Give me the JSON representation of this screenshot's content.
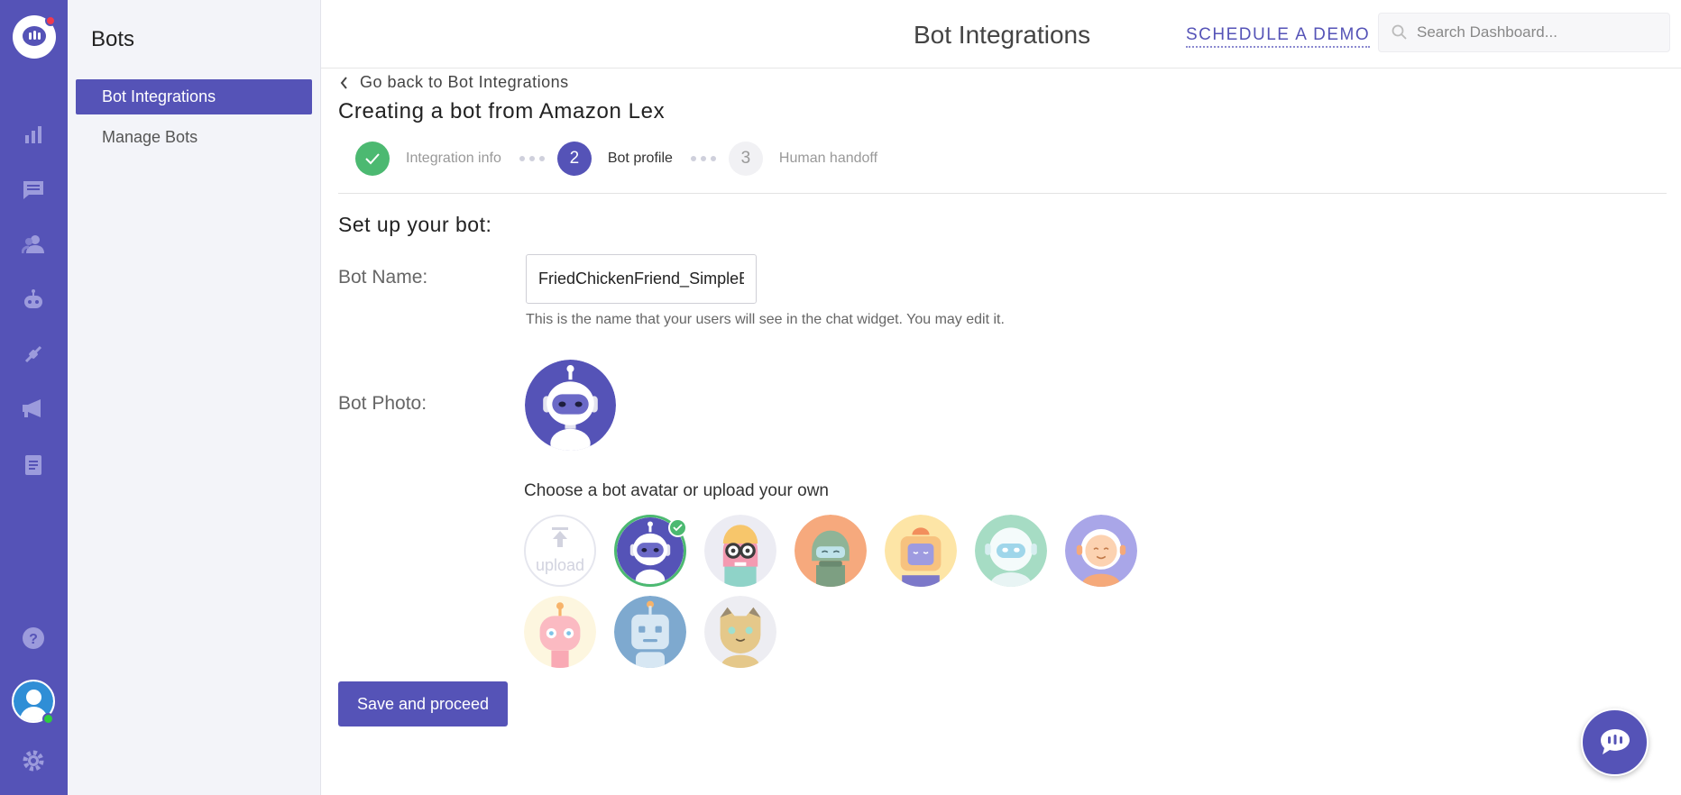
{
  "sidebar": {
    "title": "Bots",
    "items": [
      {
        "label": "Bot Integrations",
        "active": true
      },
      {
        "label": "Manage Bots",
        "active": false
      }
    ]
  },
  "rail": {
    "icons": [
      "chat-logo-icon",
      "bar-chart-icon",
      "conversations-icon",
      "users-icon",
      "bot-icon",
      "integrations-icon",
      "campaigns-megaphone-icon",
      "docs-icon",
      "help-icon",
      "user-avatar",
      "settings-gear-icon"
    ],
    "accent": "#5553b7",
    "notification_color": "#ef3b4f",
    "online_color": "#2ecc40"
  },
  "header": {
    "title": "Bot Integrations",
    "demo_link": "SCHEDULE A DEMO",
    "search_placeholder": "Search Dashboard..."
  },
  "main": {
    "back_link": "Go back to Bot Integrations",
    "heading": "Creating a bot from Amazon Lex",
    "steps": [
      {
        "number": "1",
        "label": "Integration info",
        "state": "done"
      },
      {
        "number": "2",
        "label": "Bot profile",
        "state": "current"
      },
      {
        "number": "3",
        "label": "Human handoff",
        "state": "todo"
      }
    ],
    "setup_title": "Set up your bot:",
    "bot_name_label": "Bot Name:",
    "bot_name_value": "FriedChickenFriend_SimpleBot",
    "bot_name_hint": "This is the name that your users will see in the chat widget. You may edit it.",
    "bot_photo_label": "Bot Photo:",
    "choose_text": "Choose a bot avatar or upload your own",
    "upload_label": "upload",
    "avatars": [
      "purple-robot",
      "glasses-robot",
      "green-helmet-robot",
      "yellow-bot",
      "white-helmet-bot",
      "orange-face-bot",
      "pink-bot",
      "blue-square-bot",
      "cat-bot"
    ],
    "selected_avatar": "purple-robot",
    "save_button": "Save and proceed"
  },
  "colors": {
    "success": "#4cb971",
    "accent": "#5553b7"
  }
}
